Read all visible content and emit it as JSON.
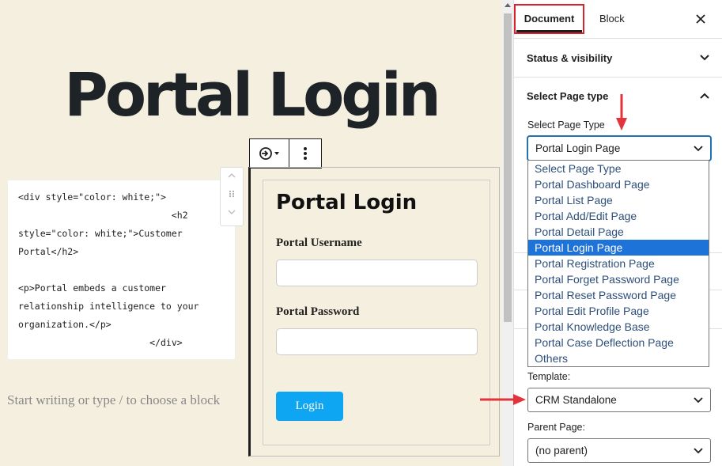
{
  "editor": {
    "page_title": "Portal Login",
    "html_block_lines": [
      "<div style=\"color: white;\">",
      "                            <h2",
      "style=\"color: white;\">Customer",
      "Portal</h2>",
      "",
      "<p>Portal embeds a customer",
      "relationship intelligence to your",
      "organization.</p>",
      "                        </div>"
    ],
    "placeholder": "Start writing or type / to choose a block"
  },
  "login_form": {
    "title": "Portal Login",
    "username_label": "Portal Username",
    "password_label": "Portal Password",
    "button_label": "Login"
  },
  "sidebar": {
    "tabs": {
      "document": "Document",
      "block": "Block"
    },
    "status_visibility": "Status & visibility",
    "select_page_type_heading": "Select Page type",
    "page_type_label": "Select Page Type",
    "page_type_value": "Portal Login Page",
    "page_type_options": [
      "Select Page Type",
      "Portal Dashboard Page",
      "Portal List Page",
      "Portal Add/Edit Page",
      "Portal Detail Page",
      "Portal Login Page",
      "Portal Registration Page",
      "Portal Forget Password Page",
      "Portal Reset Password Page",
      "Portal Edit Profile Page",
      "Portal Knowledge Base",
      "Portal Case Deflection Page",
      "Others"
    ],
    "template_label": "Template:",
    "template_value": "CRM Standalone",
    "parent_label": "Parent Page:",
    "parent_value": "(no parent)"
  },
  "colors": {
    "canvas_bg": "#f5efe0",
    "accent_blue": "#0ea5f3",
    "highlight_red": "#d6242e",
    "selected_option": "#1e73d8"
  }
}
